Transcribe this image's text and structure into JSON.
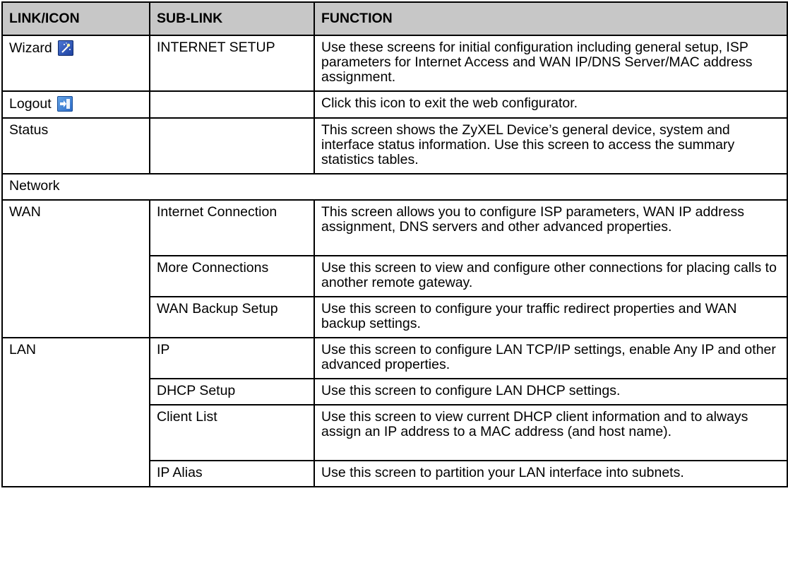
{
  "headers": [
    "LINK/ICON",
    "SUB-LINK",
    "FUNCTION"
  ],
  "rows": {
    "wizard": {
      "link": "Wizard",
      "icon": "wizard-wand-icon",
      "sub": "INTERNET SETUP",
      "func": "Use these screens for initial configuration including general setup, ISP parameters for Internet Access and WAN IP/DNS Server/MAC address assignment."
    },
    "logout": {
      "link": "Logout",
      "icon": "logout-icon",
      "sub": "",
      "func": "Click this icon to exit the web configurator."
    },
    "status": {
      "link": "Status",
      "sub": "",
      "func": "This screen shows the ZyXEL Device’s general device, system and interface status information. Use this screen to access the summary statistics tables."
    },
    "network": {
      "label": "Network"
    },
    "wan": {
      "link": "WAN",
      "subs": [
        {
          "sub": "Internet Connection",
          "func": "This screen allows you to configure ISP parameters, WAN IP address assignment, DNS servers and other advanced properties."
        },
        {
          "sub": "More Connections",
          "func": "Use this screen to view and configure other connections for placing calls to another remote gateway."
        },
        {
          "sub": "WAN Backup Setup",
          "func": "Use this screen to configure your traffic redirect properties and WAN backup settings."
        }
      ]
    },
    "lan": {
      "link": "LAN",
      "subs": [
        {
          "sub": "IP",
          "func": "Use this screen to configure LAN TCP/IP settings, enable Any IP and other advanced properties."
        },
        {
          "sub": "DHCP Setup",
          "func": "Use this screen to configure LAN DHCP settings."
        },
        {
          "sub": "Client List",
          "func": "Use this screen to view current DHCP client information and to always assign an IP address to a MAC address (and host name)."
        },
        {
          "sub": "IP Alias",
          "func": "Use this screen to partition your LAN interface into subnets."
        }
      ]
    }
  }
}
